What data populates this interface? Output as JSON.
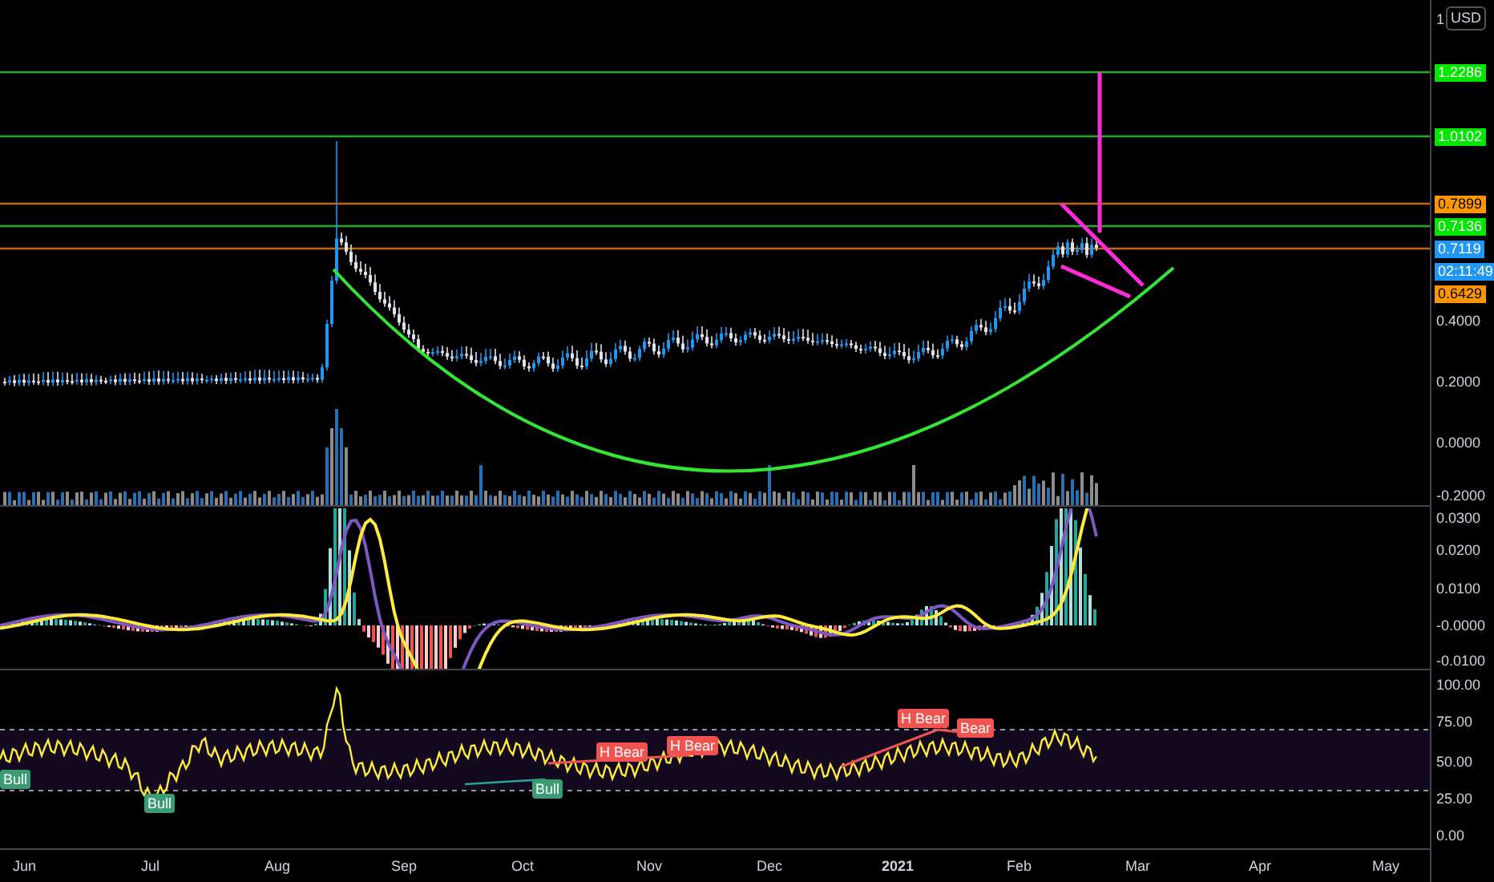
{
  "price_axis": {
    "currency": "USD",
    "ticks": [
      "1",
      "0.4000",
      "0.2000",
      "0.0000",
      "-0.2000"
    ]
  },
  "price_tags": [
    {
      "text": "1.2286",
      "color": "#00e600"
    },
    {
      "text": "1.0102",
      "color": "#00e600"
    },
    {
      "text": "0.7899",
      "color": "#ff9800"
    },
    {
      "text": "0.7136",
      "color": "#00e600"
    },
    {
      "text": "0.7119",
      "color": "#2196f3"
    },
    {
      "text": "02:11:49",
      "color": "#2196f3"
    },
    {
      "text": "0.6429",
      "color": "#ff9800"
    }
  ],
  "macd_axis": {
    "ticks": [
      "0.0300",
      "0.0200",
      "0.0100",
      "-0.0000",
      "-0.0100"
    ]
  },
  "rsi_axis": {
    "ticks": [
      "100.00",
      "75.00",
      "50.00",
      "25.00",
      "0.00"
    ]
  },
  "rsi_signals": [
    {
      "text": "Bull",
      "kind": "bull"
    },
    {
      "text": "Bull",
      "kind": "bull"
    },
    {
      "text": "Bull",
      "kind": "bull"
    },
    {
      "text": "H Bear",
      "kind": "bear"
    },
    {
      "text": "H Bear",
      "kind": "bear"
    },
    {
      "text": "H Bear",
      "kind": "bear"
    },
    {
      "text": "Bear",
      "kind": "bear"
    }
  ],
  "time_axis": [
    {
      "label": "Jun",
      "kind": "month"
    },
    {
      "label": "Jul",
      "kind": "month"
    },
    {
      "label": "Aug",
      "kind": "month"
    },
    {
      "label": "Sep",
      "kind": "month"
    },
    {
      "label": "Oct",
      "kind": "month"
    },
    {
      "label": "Nov",
      "kind": "month"
    },
    {
      "label": "Dec",
      "kind": "month"
    },
    {
      "label": "2021",
      "kind": "year"
    },
    {
      "label": "Feb",
      "kind": "month"
    },
    {
      "label": "Mar",
      "kind": "month"
    },
    {
      "label": "Apr",
      "kind": "month"
    },
    {
      "label": "May",
      "kind": "month"
    }
  ]
}
